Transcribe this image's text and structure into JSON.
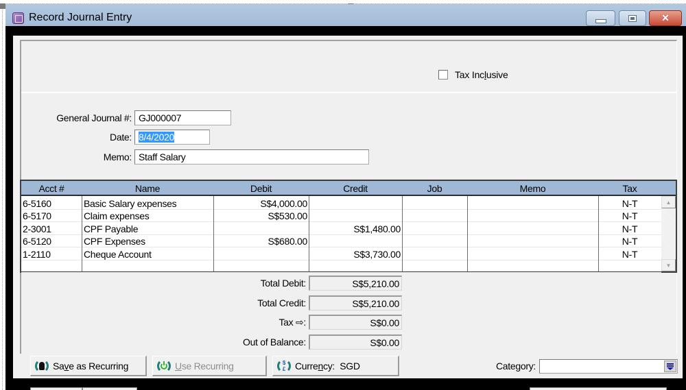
{
  "window": {
    "title": "Record Journal Entry",
    "controls": {
      "minimize": "minimize",
      "maximize": "maximize",
      "close": "×"
    }
  },
  "options": {
    "tax_inclusive_label_pre": "Tax Inc",
    "tax_inclusive_label_u": "l",
    "tax_inclusive_label_post": "usive",
    "tax_inclusive_checked": false
  },
  "header_fields": {
    "journal_label": "General Journal #:",
    "journal_value": "GJ000007",
    "date_label": "Date:",
    "date_value": "8/4/2020",
    "memo_label": "Memo:",
    "memo_value": "Staff Salary"
  },
  "grid": {
    "columns": [
      "Acct #",
      "Name",
      "Debit",
      "Credit",
      "Job",
      "Memo",
      "Tax"
    ],
    "rows": [
      {
        "acct": "6-5160",
        "name": "Basic Salary expenses",
        "debit": "S$4,000.00",
        "credit": "",
        "job": "",
        "memo": "",
        "tax": "N-T"
      },
      {
        "acct": "6-5170",
        "name": "Claim expenses",
        "debit": "S$530.00",
        "credit": "",
        "job": "",
        "memo": "",
        "tax": "N-T"
      },
      {
        "acct": "2-3001",
        "name": "CPF Payable",
        "debit": "",
        "credit": "S$1,480.00",
        "job": "",
        "memo": "",
        "tax": "N-T"
      },
      {
        "acct": "6-5120",
        "name": "CPF Expenses",
        "debit": "S$680.00",
        "credit": "",
        "job": "",
        "memo": "",
        "tax": "N-T"
      },
      {
        "acct": "1-2110",
        "name": "Cheque Account",
        "debit": "",
        "credit": "S$3,730.00",
        "job": "",
        "memo": "",
        "tax": "N-T"
      },
      {
        "acct": "",
        "name": "",
        "debit": "",
        "credit": "",
        "job": "",
        "memo": "",
        "tax": ""
      }
    ]
  },
  "totals": {
    "total_debit_label": "Total Debit:",
    "total_debit": "S$5,210.00",
    "total_credit_label": "Total Credit:",
    "total_credit": "S$5,210.00",
    "tax_label": "Tax",
    "tax_arrow": "⇨",
    "tax_colon": ":",
    "tax": "S$0.00",
    "out_of_balance_label": "Out of Balance:",
    "out_of_balance": "S$0.00"
  },
  "buttons": {
    "save_recurring": {
      "pre": "Sa",
      "u": "v",
      "post": "e as Recurring"
    },
    "use_recurring": {
      "pre": "",
      "u": "U",
      "post": "se Recurring",
      "enabled": false
    },
    "currency": {
      "pre": "Curre",
      "u": "n",
      "post": "cy:",
      "value": "SGD"
    }
  },
  "category": {
    "label": "Category:",
    "value": ""
  },
  "icons": {
    "scroll_up": "▲",
    "scroll_down": "▼",
    "currency_symbols": "$\n£"
  }
}
